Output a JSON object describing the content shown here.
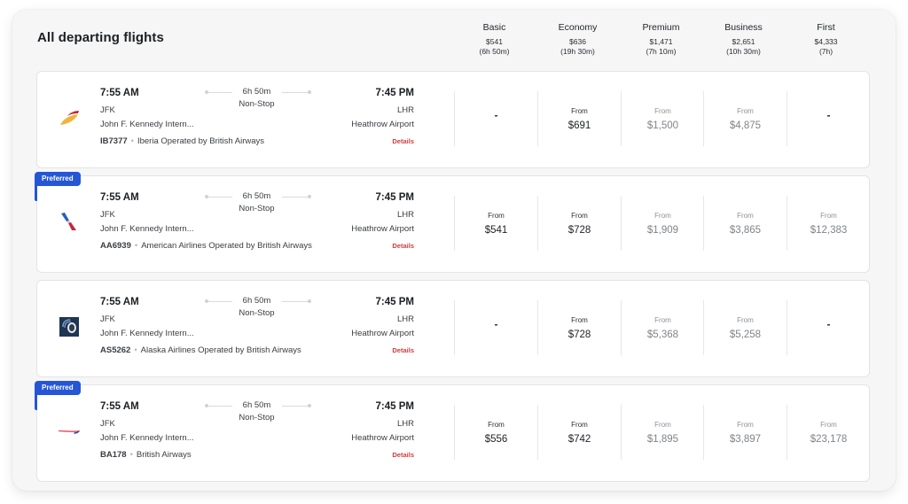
{
  "title": "All departing flights",
  "fare_classes": [
    {
      "name": "Basic",
      "price": "$541",
      "duration": "(6h 50m)"
    },
    {
      "name": "Economy",
      "price": "$636",
      "duration": "(19h 30m)"
    },
    {
      "name": "Premium",
      "price": "$1,471",
      "duration": "(7h 10m)"
    },
    {
      "name": "Business",
      "price": "$2,651",
      "duration": "(10h 30m)"
    },
    {
      "name": "First",
      "price": "$4,333",
      "duration": "(7h)"
    }
  ],
  "labels": {
    "from": "From",
    "dash": "-",
    "details": "Details",
    "preferred": "Preferred",
    "dot": "•"
  },
  "flights": [
    {
      "airline_logo": "iberia-logo",
      "preferred": false,
      "dep_time": "7:55 AM",
      "dep_code": "JFK",
      "dep_name": "John F. Kennedy Intern...",
      "duration": "6h 50m",
      "stops": "Non-Stop",
      "arr_time": "7:45 PM",
      "arr_code": "LHR",
      "arr_name": "Heathrow Airport",
      "flight_no": "IB7377",
      "operator": "Iberia Operated by British Airways",
      "fares": [
        null,
        "$691",
        "$1,500",
        "$4,875",
        null
      ]
    },
    {
      "airline_logo": "american-airlines-logo",
      "preferred": true,
      "dep_time": "7:55 AM",
      "dep_code": "JFK",
      "dep_name": "John F. Kennedy Intern...",
      "duration": "6h 50m",
      "stops": "Non-Stop",
      "arr_time": "7:45 PM",
      "arr_code": "LHR",
      "arr_name": "Heathrow Airport",
      "flight_no": "AA6939",
      "operator": "American Airlines Operated by British Airways",
      "fares": [
        "$541",
        "$728",
        "$1,909",
        "$3,865",
        "$12,383"
      ]
    },
    {
      "airline_logo": "alaska-airlines-logo",
      "preferred": false,
      "dep_time": "7:55 AM",
      "dep_code": "JFK",
      "dep_name": "John F. Kennedy Intern...",
      "duration": "6h 50m",
      "stops": "Non-Stop",
      "arr_time": "7:45 PM",
      "arr_code": "LHR",
      "arr_name": "Heathrow Airport",
      "flight_no": "AS5262",
      "operator": "Alaska Airlines Operated by British Airways",
      "fares": [
        null,
        "$728",
        "$5,368",
        "$5,258",
        null
      ]
    },
    {
      "airline_logo": "british-airways-logo",
      "preferred": true,
      "dep_time": "7:55 AM",
      "dep_code": "JFK",
      "dep_name": "John F. Kennedy Intern...",
      "duration": "6h 50m",
      "stops": "Non-Stop",
      "arr_time": "7:45 PM",
      "arr_code": "LHR",
      "arr_name": "Heathrow Airport",
      "flight_no": "BA178",
      "operator": "British Airways",
      "fares": [
        "$556",
        "$742",
        "$1,895",
        "$3,897",
        "$23,178"
      ]
    }
  ],
  "colors": {
    "preferred_badge": "#2456d6",
    "details_link": "#d23b3b"
  }
}
